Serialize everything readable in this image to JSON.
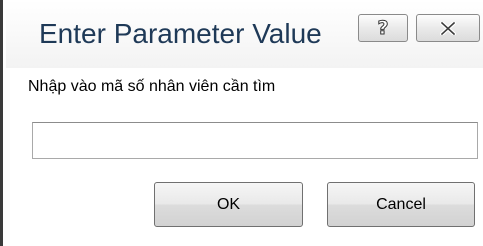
{
  "window": {
    "title": "Enter Parameter Value",
    "help_icon": "question-mark-icon",
    "close_icon": "close-x-icon"
  },
  "prompt": {
    "text": "Nhập vào mã số nhân viên cần tìm"
  },
  "input": {
    "value": "",
    "placeholder": ""
  },
  "buttons": {
    "ok_label": "OK",
    "cancel_label": "Cancel"
  }
}
